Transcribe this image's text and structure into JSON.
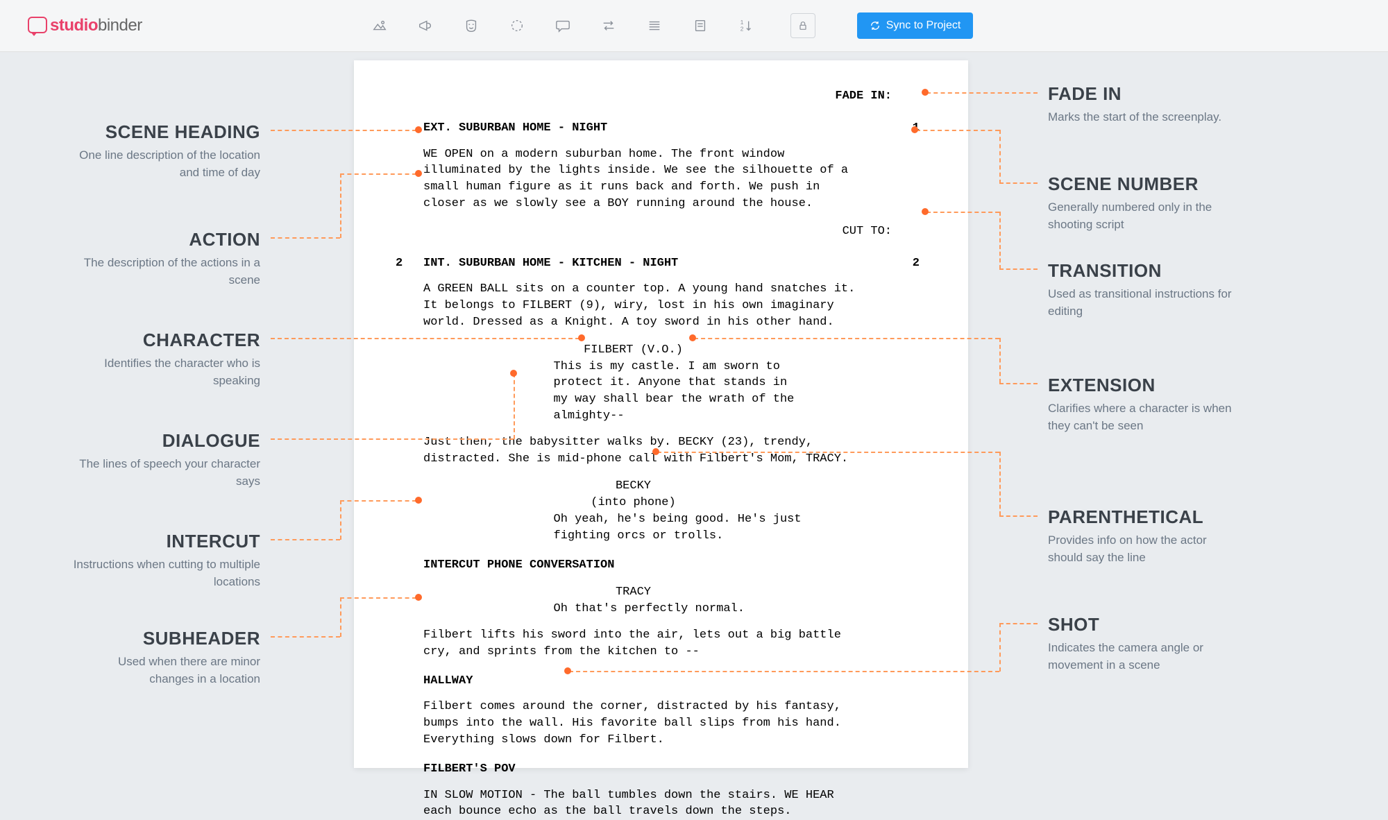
{
  "logo": {
    "brand1": "studio",
    "brand2": "binder"
  },
  "toolbar": {
    "sync_label": "Sync to Project"
  },
  "script": {
    "fade_in": "FADE IN:",
    "scene1": {
      "num": "1",
      "heading": "EXT. SUBURBAN HOME - NIGHT"
    },
    "action1": "WE OPEN on a modern suburban home. The front window illuminated by the lights inside. We see the silhouette of a small human figure as it runs back and forth. We push in closer as we slowly see a BOY running around the house.",
    "cut_to": "CUT TO:",
    "scene2": {
      "num": "2",
      "heading": "INT. SUBURBAN HOME - KITCHEN - NIGHT"
    },
    "action2": "A GREEN BALL sits on a counter top. A young hand snatches it. It belongs to FILBERT (9), wiry, lost in his own imaginary world. Dressed as a Knight. A toy sword in his other hand.",
    "char1": "FILBERT (V.O.)",
    "dialogue1": "This is my castle. I am sworn to protect it. Anyone that stands in my way shall bear the wrath of the almighty--",
    "action3": "Just then, the babysitter walks by. BECKY (23), trendy, distracted. She is mid-phone call with Filbert's Mom, TRACY.",
    "char2": "BECKY",
    "paren2": "(into phone)",
    "dialogue2": "Oh yeah, he's being good. He's just fighting orcs or trolls.",
    "intercut": "INTERCUT PHONE CONVERSATION",
    "char3": "TRACY",
    "dialogue3": "Oh that's perfectly normal.",
    "action4": "Filbert lifts his sword into the air, lets out a big battle cry, and sprints from the kitchen to --",
    "sub1": "HALLWAY",
    "action5": "Filbert comes around the corner, distracted by his fantasy, bumps into the wall. His favorite ball slips from his hand. Everything slows down for Filbert.",
    "sub2": "FILBERT'S POV",
    "action6": "IN SLOW MOTION - The ball tumbles down the stairs. WE HEAR each bounce echo as the ball travels down the steps."
  },
  "labels": {
    "scene_heading": {
      "t": "SCENE HEADING",
      "d": "One line description of the location and time of day"
    },
    "action": {
      "t": "ACTION",
      "d": "The description of the actions in a scene"
    },
    "character": {
      "t": "CHARACTER",
      "d": "Identifies the character who is speaking"
    },
    "dialogue": {
      "t": "DIALOGUE",
      "d": "The lines of speech your character says"
    },
    "intercut": {
      "t": "INTERCUT",
      "d": "Instructions when cutting to multiple locations"
    },
    "subheader": {
      "t": "SUBHEADER",
      "d": "Used when there are minor changes in a location"
    },
    "fade_in": {
      "t": "FADE IN",
      "d": "Marks the start of the screenplay."
    },
    "scene_number": {
      "t": "SCENE NUMBER",
      "d": "Generally numbered only in the shooting script"
    },
    "transition": {
      "t": "TRANSITION",
      "d": "Used as transitional instructions for editing"
    },
    "extension": {
      "t": "EXTENSION",
      "d": "Clarifies where a character is when they can't be seen"
    },
    "parenthetical": {
      "t": "PARENTHETICAL",
      "d": "Provides info on how the actor should say the line"
    },
    "shot": {
      "t": "SHOT",
      "d": "Indicates the camera angle or movement in a scene"
    }
  }
}
